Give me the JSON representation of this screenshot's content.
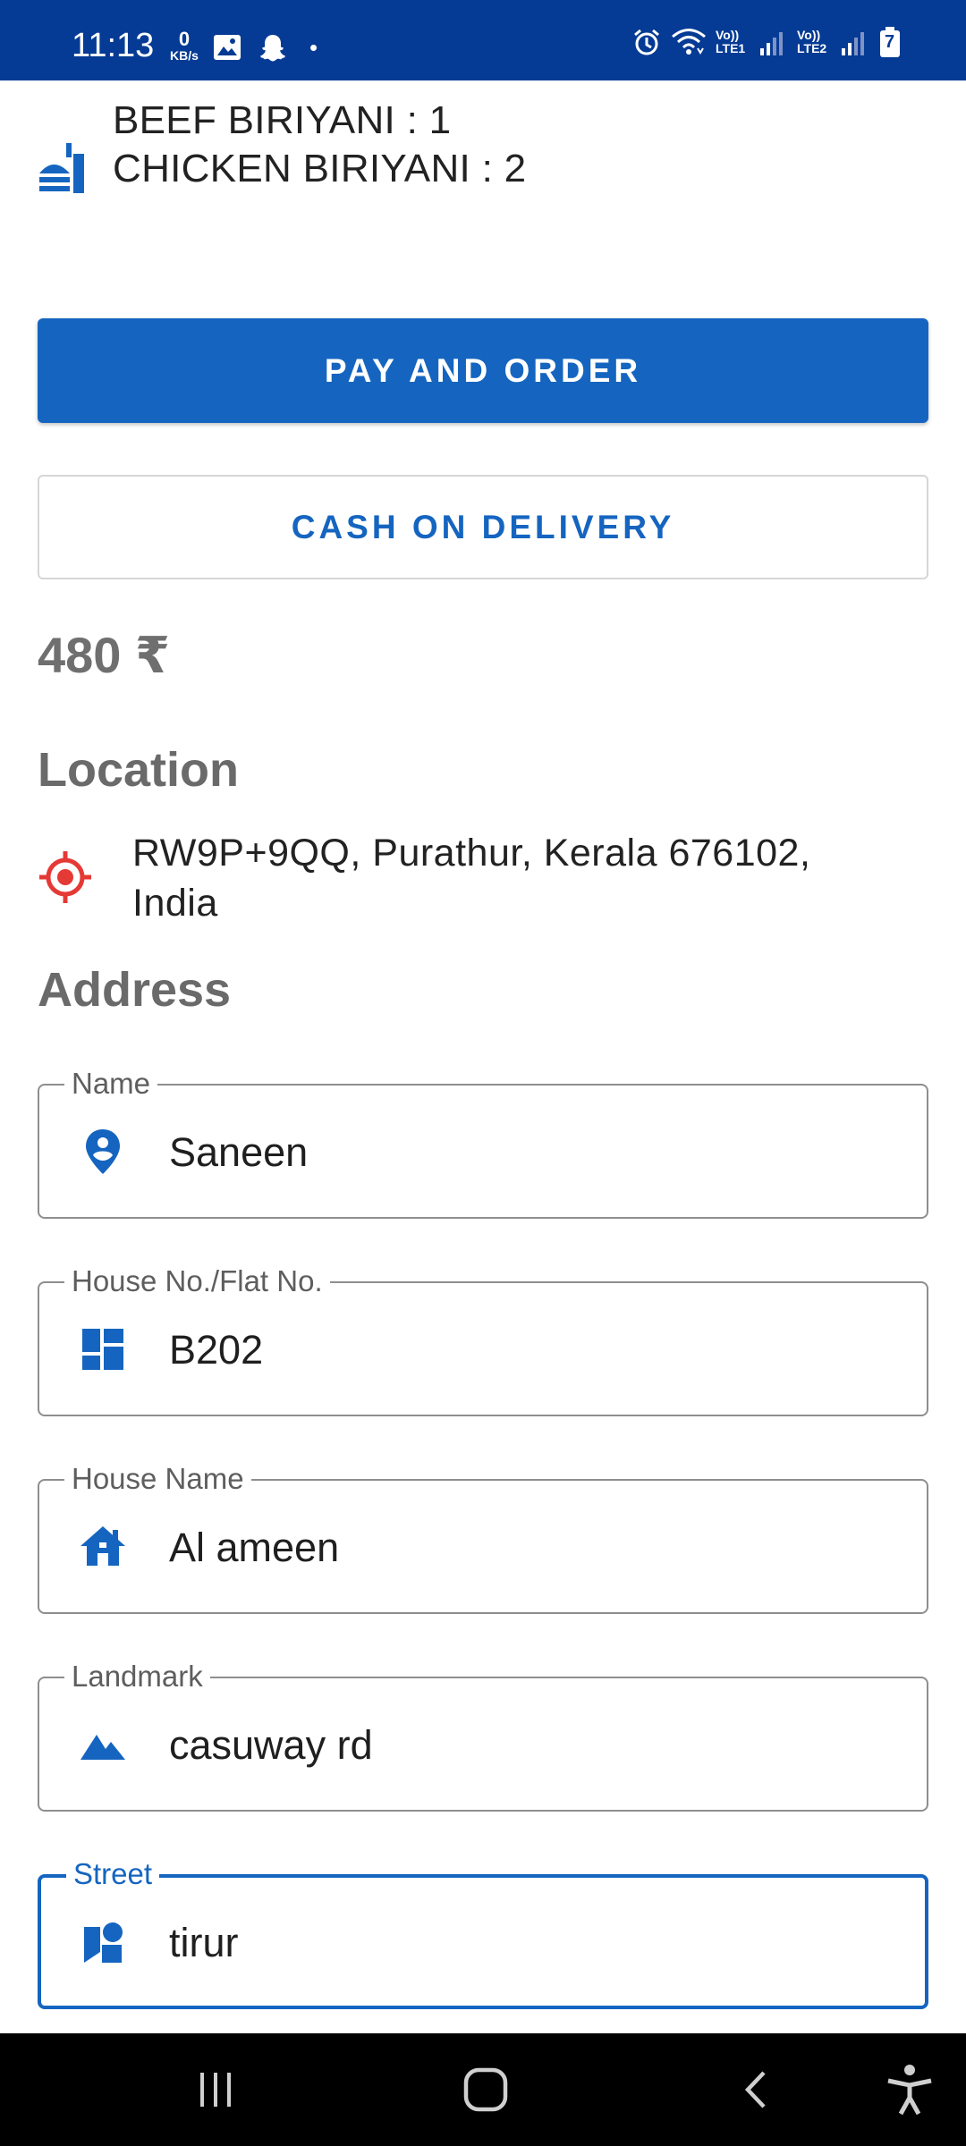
{
  "status_bar": {
    "time": "11:13",
    "data_speed_value": "0",
    "data_speed_unit": "KB/s",
    "dot": "•",
    "sim1_label": "Vo)) LTE1",
    "sim2_label": "Vo)) LTE2",
    "battery_level": "7",
    "left_icons": [
      "image-icon",
      "snapchat-icon"
    ],
    "right_icons": [
      "alarm-icon",
      "wifi-icon",
      "signal-icon",
      "battery-icon"
    ]
  },
  "order": {
    "icon": "food-icon",
    "items": [
      {
        "text": "BEEF BIRIYANI : 1"
      },
      {
        "text": "CHICKEN BIRIYANI : 2"
      }
    ]
  },
  "actions": {
    "pay_label": "PAY AND ORDER",
    "cod_label": "CASH ON DELIVERY"
  },
  "total": "480 ₹",
  "location": {
    "title": "Location",
    "icon": "gps-target-icon",
    "address": "RW9P+9QQ, Purathur, Kerala 676102, India"
  },
  "address": {
    "title": "Address",
    "fields": [
      {
        "label": "Name",
        "value": "Saneen",
        "icon": "person-pin-icon"
      },
      {
        "label": "House No./Flat No.",
        "value": "B202",
        "icon": "dashboard-icon"
      },
      {
        "label": "House Name",
        "value": "Al ameen",
        "icon": "house-icon"
      },
      {
        "label": "Landmark",
        "value": "casuway rd",
        "icon": "landscape-icon"
      },
      {
        "label": "Street",
        "value": "tirur",
        "icon": "street-shapes-icon"
      }
    ]
  },
  "colors": {
    "status_bar": "#053b94",
    "primary": "#1565c0",
    "location_icon": "#e53935",
    "nav_bar": "#000000"
  },
  "nav_bar": {
    "buttons": [
      "recent-apps-icon",
      "home-icon",
      "back-icon",
      "accessibility-icon"
    ]
  }
}
